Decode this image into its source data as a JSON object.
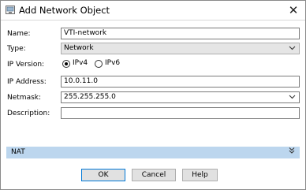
{
  "window": {
    "title": "Add Network Object",
    "close_glyph": "✕"
  },
  "form": {
    "name_label": "Name:",
    "name_value": "VTI-network",
    "type_label": "Type:",
    "type_value": "Network",
    "ip_version_label": "IP Version:",
    "ip_version_options": [
      "IPv4",
      "IPv6"
    ],
    "ip_version_selected": "IPv4",
    "ip_address_label": "IP Address:",
    "ip_address_value": "10.0.11.0",
    "netmask_label": "Netmask:",
    "netmask_value": "255.255.255.0",
    "description_label": "Description:",
    "description_value": ""
  },
  "nat": {
    "label": "NAT",
    "chevron_icon": "double-chevron-down-icon"
  },
  "buttons": {
    "ok": "OK",
    "cancel": "Cancel",
    "help": "Help"
  },
  "colors": {
    "nat_bar": "#bcd6ee",
    "default_button_border": "#0078d7",
    "select_bg": "#e5e5e5"
  }
}
